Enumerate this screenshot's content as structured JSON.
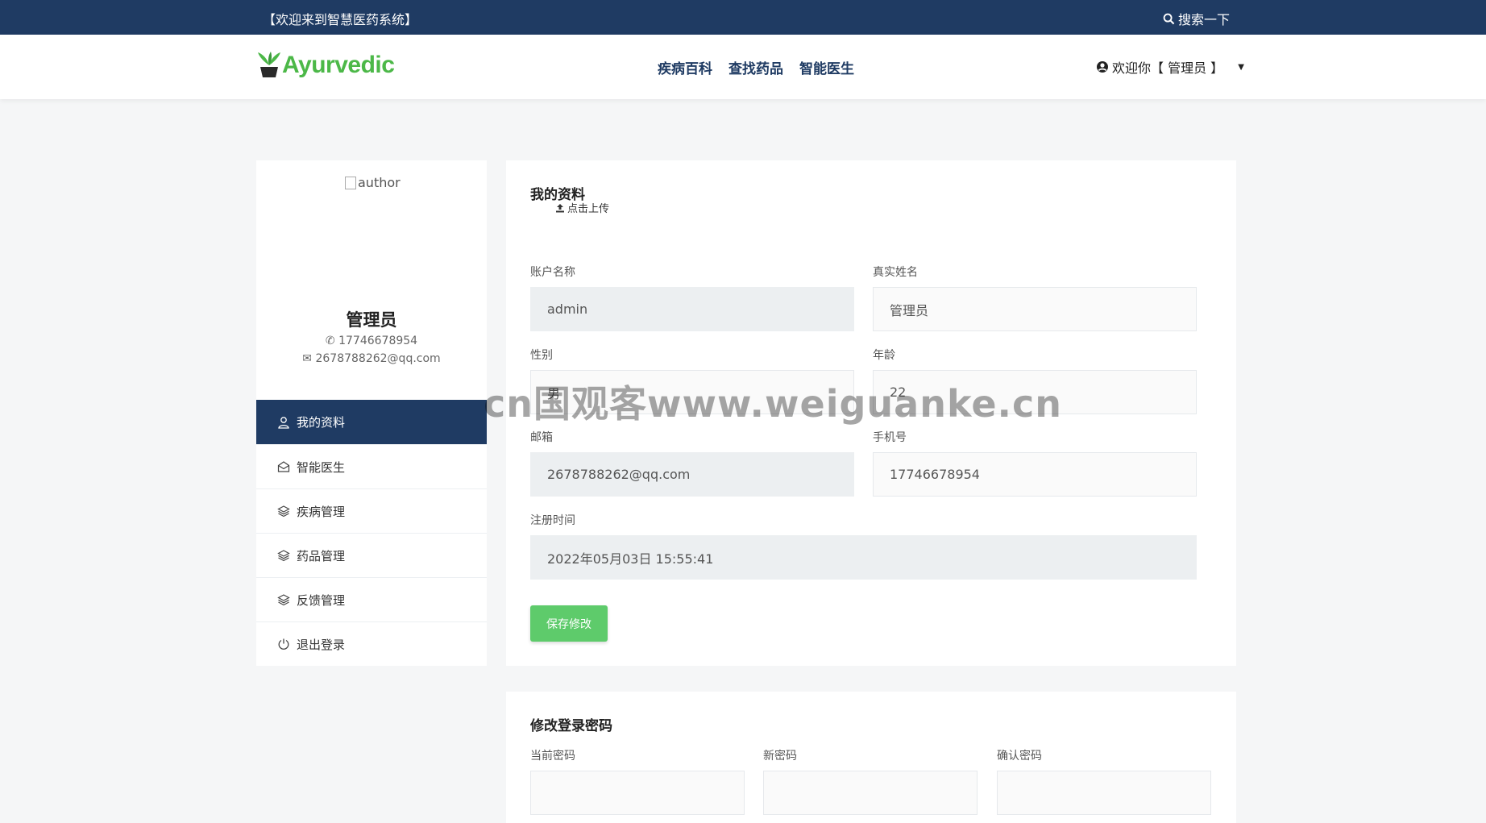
{
  "topbar": {
    "welcome": "【欢迎来到智慧医药系统】",
    "search_label": "搜索一下"
  },
  "header": {
    "brand": "Ayurvedic",
    "nav": [
      "疾病百科",
      "查找药品",
      "智能医生"
    ],
    "user_menu": "欢迎你【 管理员 】"
  },
  "sidebar": {
    "avatar_alt": "author",
    "name": "管理员",
    "phone": "17746678954",
    "email": "2678788262@qq.com",
    "menu": [
      {
        "label": "我的资料",
        "icon": "user-icon",
        "active": true
      },
      {
        "label": "智能医生",
        "icon": "envelope-open-icon",
        "active": false
      },
      {
        "label": "疾病管理",
        "icon": "layers-icon",
        "active": false
      },
      {
        "label": "药品管理",
        "icon": "layers-icon",
        "active": false
      },
      {
        "label": "反馈管理",
        "icon": "layers-icon",
        "active": false
      },
      {
        "label": "退出登录",
        "icon": "power-icon",
        "active": false
      }
    ]
  },
  "profile_form": {
    "title": "我的资料",
    "upload_label": "点击上传",
    "fields": {
      "account": {
        "label": "账户名称",
        "value": "admin"
      },
      "realname": {
        "label": "真实姓名",
        "value": "管理员"
      },
      "gender": {
        "label": "性别",
        "value": "男"
      },
      "age": {
        "label": "年龄",
        "value": "22"
      },
      "email": {
        "label": "邮箱",
        "value": "2678788262@qq.com"
      },
      "phone": {
        "label": "手机号",
        "value": "17746678954"
      },
      "registered": {
        "label": "注册时间",
        "value": "2022年05月03日 15:55:41"
      }
    },
    "save_label": "保存修改"
  },
  "password_form": {
    "title": "修改登录密码",
    "current_label": "当前密码",
    "new_label": "新密码",
    "confirm_label": "确认密码"
  },
  "watermark": "cn国观客www.weiguanke.cn",
  "colors": {
    "primary": "#1f3b63",
    "accent_green": "#4cb848",
    "button_green": "#5ecb6b"
  }
}
